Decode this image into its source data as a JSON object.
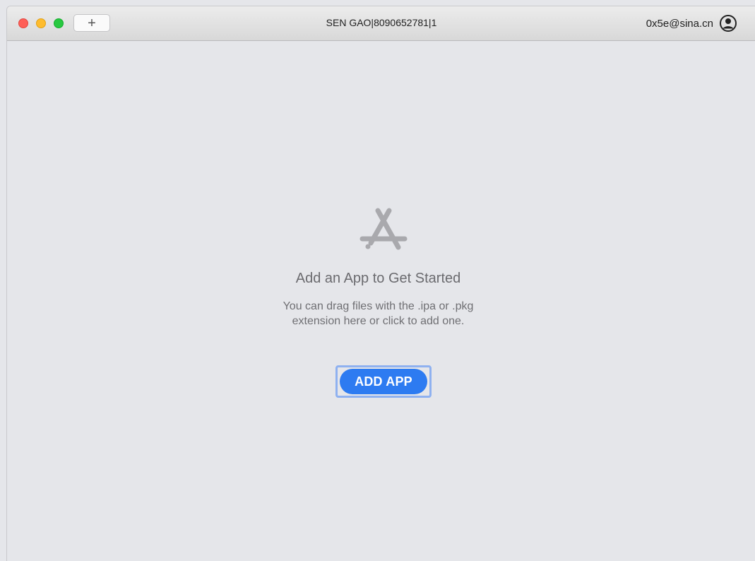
{
  "window": {
    "title": "SEN GAO|8090652781|1",
    "new_tab_label": "+",
    "account_email": "0x5e@sina.cn"
  },
  "empty_state": {
    "heading": "Add an App to Get Started",
    "subtext_line1": "You can drag files with the .ipa or .pkg",
    "subtext_line2": "extension here or click to add one.",
    "button_label": "ADD APP"
  },
  "colors": {
    "accent": "#2d7bf1",
    "close": "#fe5f57",
    "minimize": "#febc2e",
    "zoom": "#28c840"
  },
  "icons": {
    "account": "person-circle-icon",
    "empty_state": "app-store-icon"
  }
}
